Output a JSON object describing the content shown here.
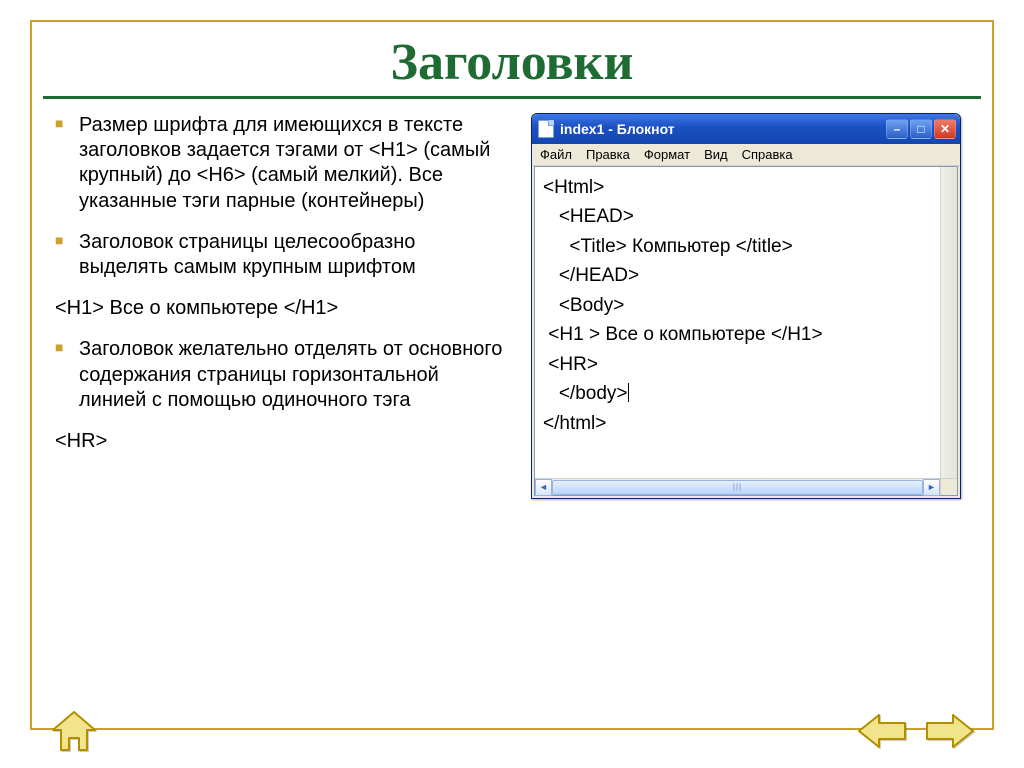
{
  "slide": {
    "title": "Заголовки",
    "bullets": [
      "Размер шрифта для имеющихся в тексте заголовков задается тэгами от <H1> (самый крупный) до <H6> (самый мелкий). Все указанные тэги парные (контейнеры)",
      "Заголовок страницы целесообразно выделять самым крупным шрифтом",
      "Заголовок желательно отделять от основного содержания страницы горизонтальной линией с помощью одиночного тэга"
    ],
    "code_example": "<H1> Все о компьютере </H1>",
    "trailing_tag": "<HR>"
  },
  "notepad": {
    "title": "index1 - Блокнот",
    "menu": {
      "file": "Файл",
      "edit": "Правка",
      "format": "Формат",
      "view": "Вид",
      "help": "Справка"
    },
    "content_lines": [
      "<Html>",
      "   <HEAD>",
      "     <Title> Компьютер </title>",
      "   </HEAD>",
      "   <Body>",
      " <H1 > Все о компьютере </H1>",
      " <HR>",
      "   </body>",
      "</html>"
    ]
  },
  "nav": {
    "home": "home",
    "prev": "prev",
    "next": "next"
  }
}
